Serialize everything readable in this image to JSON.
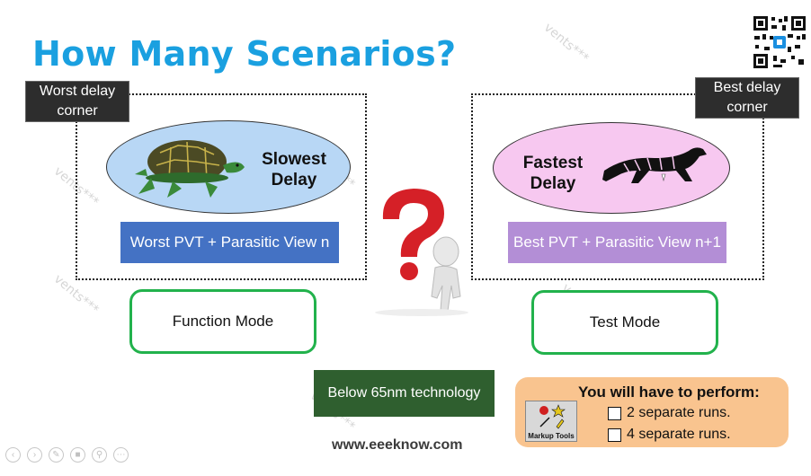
{
  "slide": {
    "title": "How Many Scenarios?",
    "left": {
      "corner_tag": "Worst delay corner",
      "oval_label_line1": "Slowest",
      "oval_label_line2": "Delay",
      "oval_color": "#b8d7f5",
      "view_bar": "Worst PVT + Parasitic View n",
      "view_bar_color": "#4472c4",
      "mode_label": "Function Mode",
      "animal_icon": "turtle-icon"
    },
    "right": {
      "corner_tag": "Best delay corner",
      "oval_label_line1": "Fastest",
      "oval_label_line2": "Delay",
      "oval_color": "#f7c8f0",
      "view_bar": "Best PVT + Parasitic View n+1",
      "view_bar_color": "#b38ed6",
      "mode_label": "Test Mode",
      "animal_icon": "tiger-icon"
    },
    "center_icon": "question-figure-icon",
    "technology_box": "Below 65nm technology",
    "technology_box_color": "#2f5f2f",
    "perform": {
      "title": "You will have to perform:",
      "options": [
        "2 separate runs.",
        "4 separate runs."
      ],
      "background": "#f9c48f"
    },
    "markup_tools_label": "Markup Tools",
    "footer_url": "www.eeeknow.com",
    "mode_border_color": "#22b24c",
    "title_color": "#1aa0e0"
  },
  "controls": [
    "prev-icon",
    "next-icon",
    "pen-icon",
    "slides-icon",
    "zoom-icon",
    "more-icon"
  ]
}
